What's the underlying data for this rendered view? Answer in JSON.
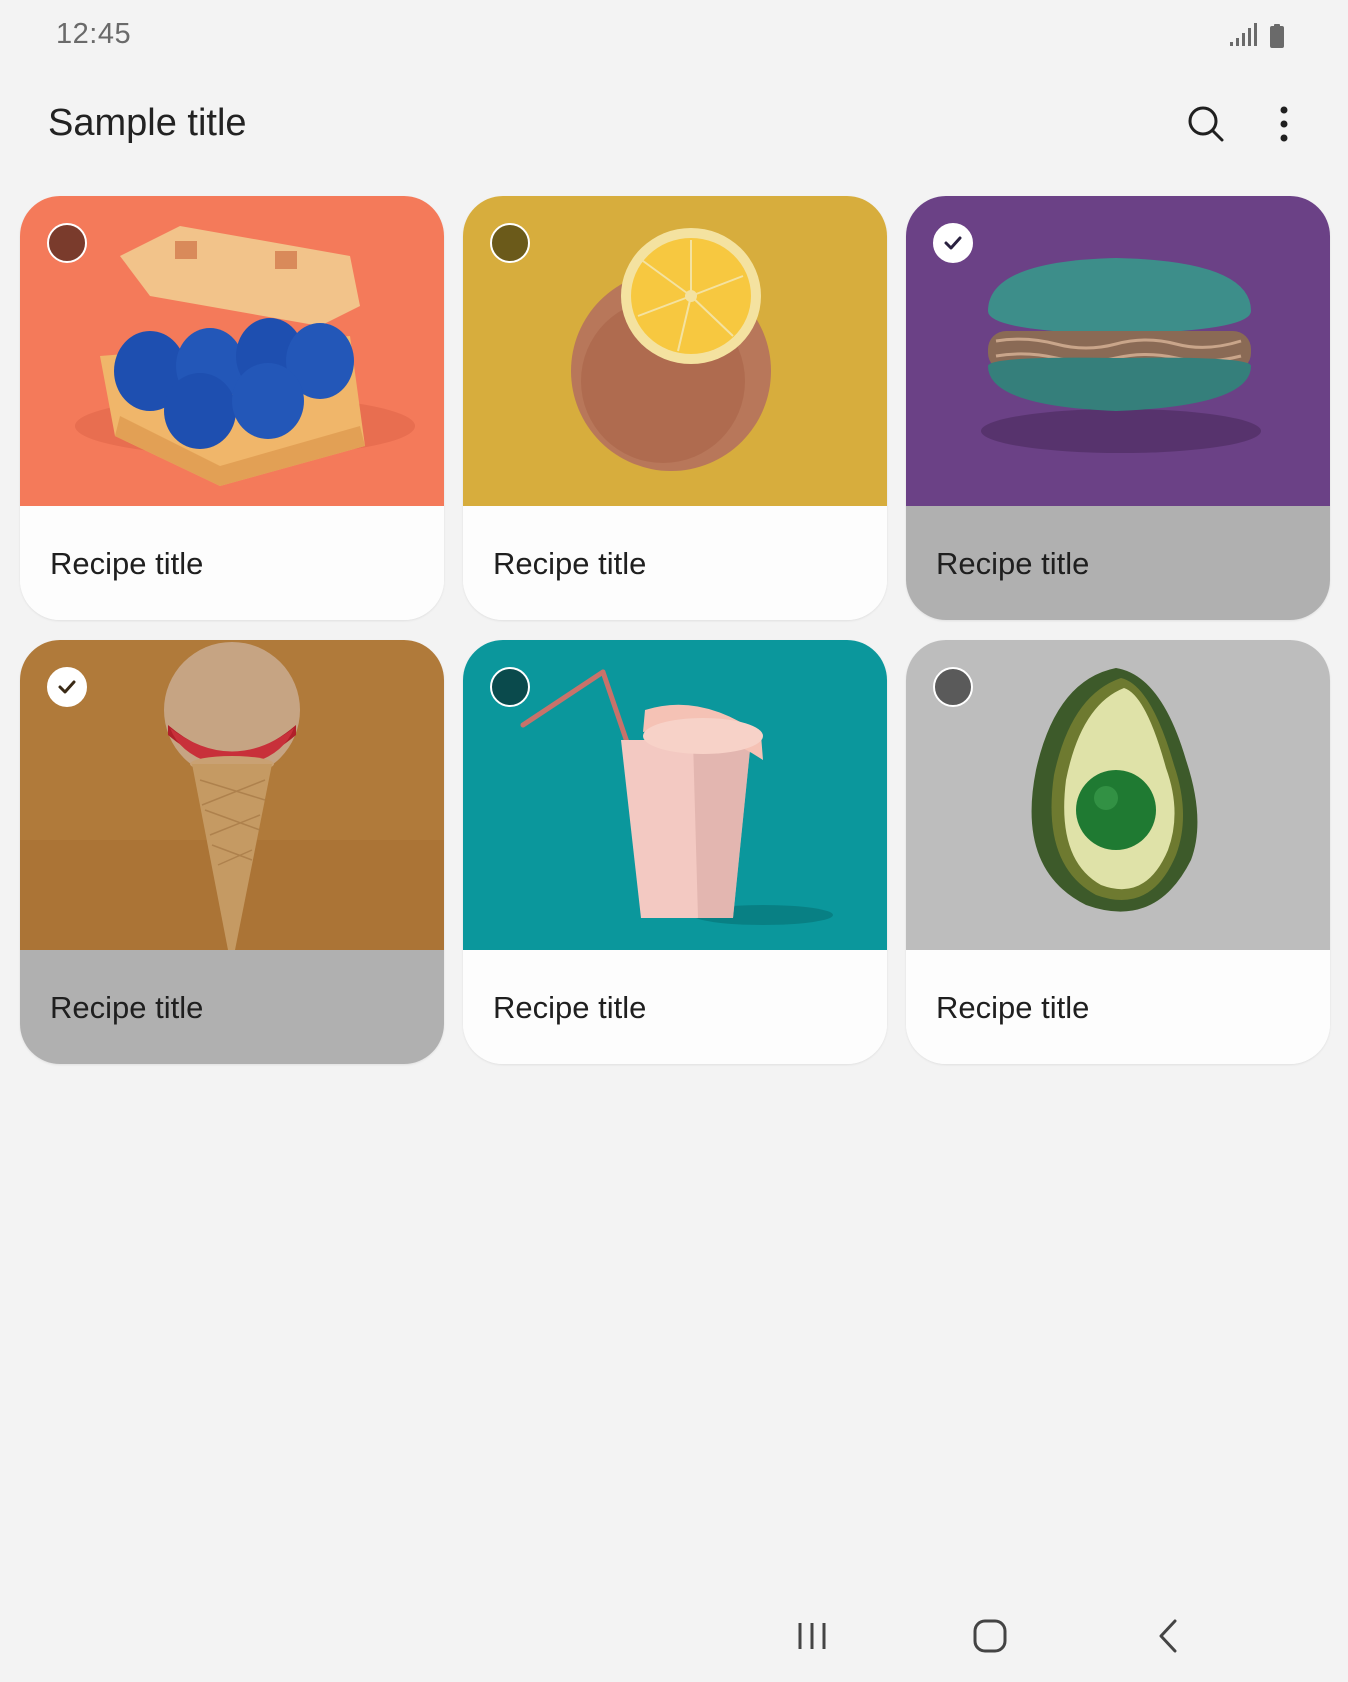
{
  "status_bar": {
    "time": "12:45",
    "icons": [
      "signal-icon",
      "battery-icon"
    ]
  },
  "app_bar": {
    "title": "Sample title",
    "actions": [
      "search-icon",
      "more-vert-icon"
    ]
  },
  "cards": [
    {
      "title": "Recipe title",
      "image": "egg-carton-image",
      "selected": false,
      "bg_color": "#f47a5a",
      "checkbox_color": "#7a3b2c"
    },
    {
      "title": "Recipe title",
      "image": "lemon-image",
      "selected": false,
      "bg_color": "#d7ad3d",
      "checkbox_color": "#6b5a1a"
    },
    {
      "title": "Recipe title",
      "image": "macaron-image",
      "selected": true,
      "bg_color": "#6b4186",
      "checkbox_color": "#ffffff"
    },
    {
      "title": "Recipe title",
      "image": "ice-cream-cone-image",
      "selected": true,
      "bg_color": "#b07a3a",
      "checkbox_color": "#ffffff"
    },
    {
      "title": "Recipe title",
      "image": "coffee-cup-image",
      "selected": false,
      "bg_color": "#0b979c",
      "checkbox_color": "#0a4a4c"
    },
    {
      "title": "Recipe title",
      "image": "avocado-image",
      "selected": false,
      "bg_color": "#bdbdbd",
      "checkbox_color": "#5a5a5a"
    }
  ],
  "nav_bar": {
    "buttons": [
      "recents-icon",
      "home-icon",
      "back-icon"
    ]
  },
  "colors": {
    "background": "#f3f3f3",
    "card": "#fdfdfd",
    "selected_footer": "#b0b0b0",
    "text": "#1f1f1f"
  }
}
